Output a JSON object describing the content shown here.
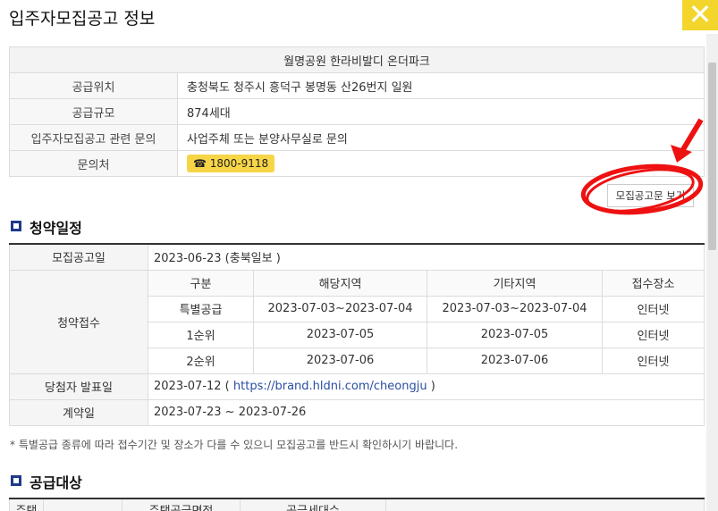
{
  "window": {
    "title": "입주자모집공고 정보",
    "close_icon": "close-x-icon"
  },
  "info": {
    "complex_name": "월명공원 한라비발디 온더파크",
    "rows": [
      {
        "label": "공급위치",
        "value": "충청북도 청주시 흥덕구 봉명동 산26번지 일원"
      },
      {
        "label": "공급규모",
        "value": "874세대"
      },
      {
        "label": "입주자모집공고 관련 문의",
        "value": "사업주체 또는 분양사무실로 문의"
      },
      {
        "label": "문의처",
        "phone": "☎ 1800-9118"
      }
    ]
  },
  "notice_button": {
    "label": "모집공고문 보기"
  },
  "schedule": {
    "title": "청약일정",
    "announcement": {
      "label": "모집공고일",
      "value": "2023-06-23 (충북일보 )"
    },
    "reception": {
      "label": "청약접수",
      "headers": [
        "구분",
        "해당지역",
        "기타지역",
        "접수장소"
      ],
      "rows": [
        [
          "특별공급",
          "2023-07-03~2023-07-04",
          "2023-07-03~2023-07-04",
          "인터넷"
        ],
        [
          "1순위",
          "2023-07-05",
          "2023-07-05",
          "인터넷"
        ],
        [
          "2순위",
          "2023-07-06",
          "2023-07-06",
          "인터넷"
        ]
      ]
    },
    "winner": {
      "label": "당첨자 발표일",
      "date": "2023-07-12 ( ",
      "link": "https://brand.hldni.com/cheongju",
      "suffix": " )"
    },
    "contract": {
      "label": "계약일",
      "value": "2023-07-23 ~ 2023-07-26"
    }
  },
  "footnote": "* 특별공급 종류에 따라 접수기간 및 장소가 다를 수 있으니 모집공고를 반드시 확인하시기 바랍니다.",
  "supply": {
    "title": "공급대상",
    "headers": [
      "주택",
      "",
      "주택공급면적",
      "공급세대수"
    ]
  }
}
